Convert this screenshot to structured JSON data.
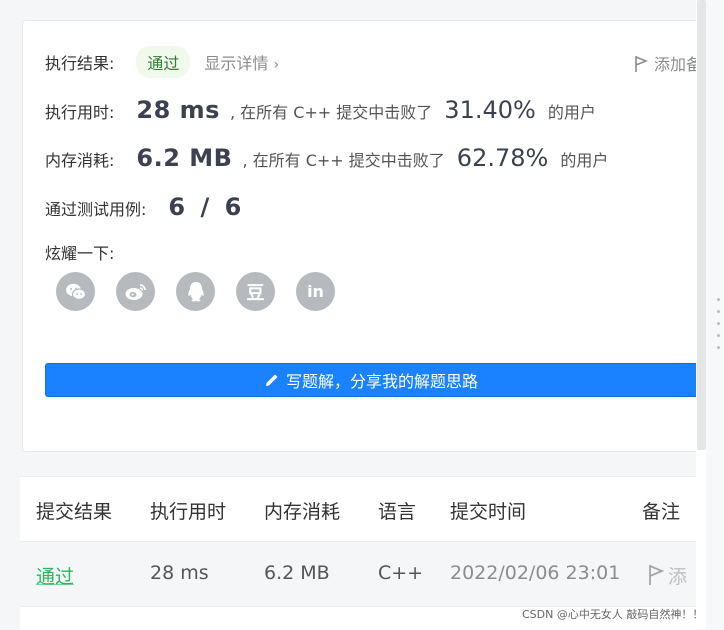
{
  "result": {
    "label": "执行结果:",
    "status": "通过",
    "details_link": "显示详情",
    "add_note": "添加备"
  },
  "runtime": {
    "label": "执行用时:",
    "value": "28 ms",
    "middle_text": ", 在所有 C++ 提交中击败了",
    "percent": "31.40%",
    "suffix": "的用户"
  },
  "memory": {
    "label": "内存消耗:",
    "value": "6.2 MB",
    "middle_text": ", 在所有 C++ 提交中击败了",
    "percent": "62.78%",
    "suffix": "的用户"
  },
  "tests": {
    "label": "通过测试用例:",
    "value": "6 / 6"
  },
  "share": {
    "label": "炫耀一下:",
    "icons": [
      "wechat-icon",
      "weibo-icon",
      "qq-icon",
      "douban-icon",
      "linkedin-icon"
    ],
    "douban_glyph": "豆",
    "linkedin_glyph": "in"
  },
  "solution_button": {
    "label": "写题解，分享我的解题思路"
  },
  "submissions": {
    "headers": [
      "提交结果",
      "执行用时",
      "内存消耗",
      "语言",
      "提交时间",
      "备注"
    ],
    "rows": [
      {
        "status": "通过",
        "runtime": "28 ms",
        "memory": "6.2 MB",
        "language": "C++",
        "time": "2022/02/06 23:01",
        "note": "添"
      }
    ]
  },
  "watermark": "CSDN @心中无女人 敲码自然神！！",
  "colors": {
    "accent": "#1a82ff",
    "success": "#2db55d",
    "icon_gray": "#b6b9be"
  }
}
